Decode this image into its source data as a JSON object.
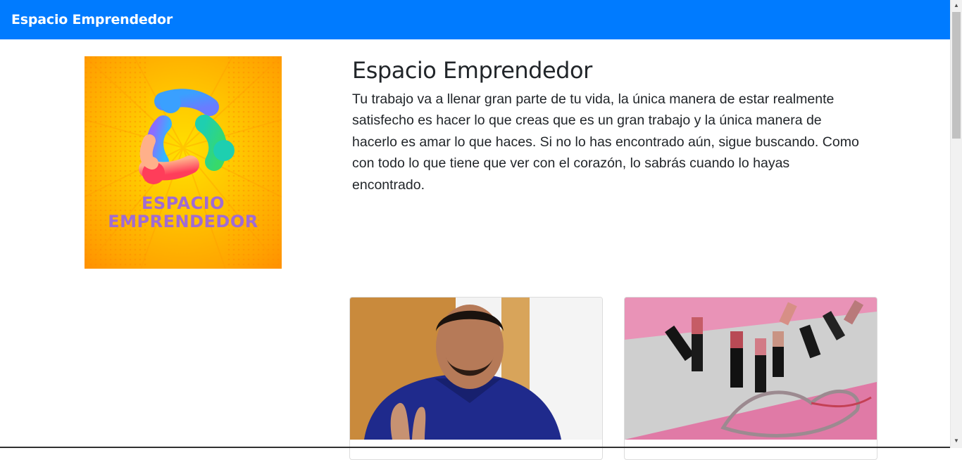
{
  "navbar": {
    "brand": "Espacio Emprendedor"
  },
  "logo": {
    "line1": "ESPACIO",
    "line2": "EMPRENDEDOR"
  },
  "hero": {
    "title": "Espacio Emprendedor",
    "description": "Tu trabajo va a llenar gran parte de tu vida, la única manera de estar realmente satisfecho es hacer lo que creas que es un gran trabajo y la única manera de hacerlo es amar lo que haces. Si no lo has encontrado aún, sigue buscando. Como con todo lo que tiene que ver con el corazón, lo sabrás cuando lo hayas encontrado."
  },
  "cards": [
    {
      "image": "man-video-photo"
    },
    {
      "image": "lipsticks-photo"
    }
  ],
  "colors": {
    "navbar": "#007bff",
    "logo_text": "#a06bd3"
  }
}
